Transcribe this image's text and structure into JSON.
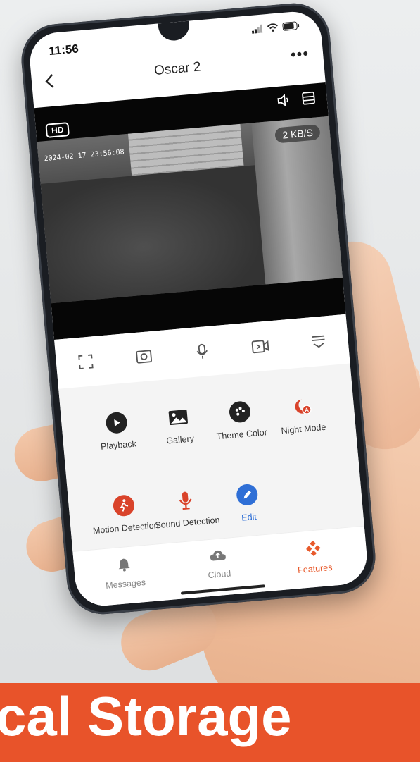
{
  "status_bar": {
    "time": "11:56"
  },
  "header": {
    "title": "Oscar 2",
    "back_icon": "chevron-left-icon",
    "more_label": "•••"
  },
  "video": {
    "quality_badge": "HD",
    "timestamp": "2024-02-17 23:56:08",
    "bitrate": "2 KB/S"
  },
  "controls": [
    {
      "icon": "fullscreen-icon"
    },
    {
      "icon": "screenshot-icon"
    },
    {
      "icon": "microphone-icon"
    },
    {
      "icon": "record-video-icon"
    },
    {
      "icon": "collapse-icon"
    }
  ],
  "features": [
    {
      "label": "Playback",
      "icon": "play-icon",
      "color": "#222222"
    },
    {
      "label": "Gallery",
      "icon": "image-icon",
      "color": "#222222"
    },
    {
      "label": "Theme Color",
      "icon": "palette-icon",
      "color": "#222222"
    },
    {
      "label": "Night Mode",
      "icon": "night-mode-icon",
      "color": "#d9432a"
    },
    {
      "label": "Motion Detection",
      "icon": "motion-icon",
      "color": "#d9432a"
    },
    {
      "label": "Sound Detection",
      "icon": "sound-icon",
      "color": "#d9432a"
    },
    {
      "label": "Edit",
      "icon": "edit-icon",
      "color": "#2f6fd6"
    }
  ],
  "tabs": [
    {
      "label": "Messages",
      "icon": "bell-icon"
    },
    {
      "label": "Cloud",
      "icon": "cloud-icon"
    },
    {
      "label": "Features",
      "icon": "features-icon",
      "active": true
    }
  ],
  "banner": {
    "text": "cal Storage"
  },
  "colors": {
    "accent": "#e8532a",
    "edit_blue": "#2f6fd6"
  }
}
